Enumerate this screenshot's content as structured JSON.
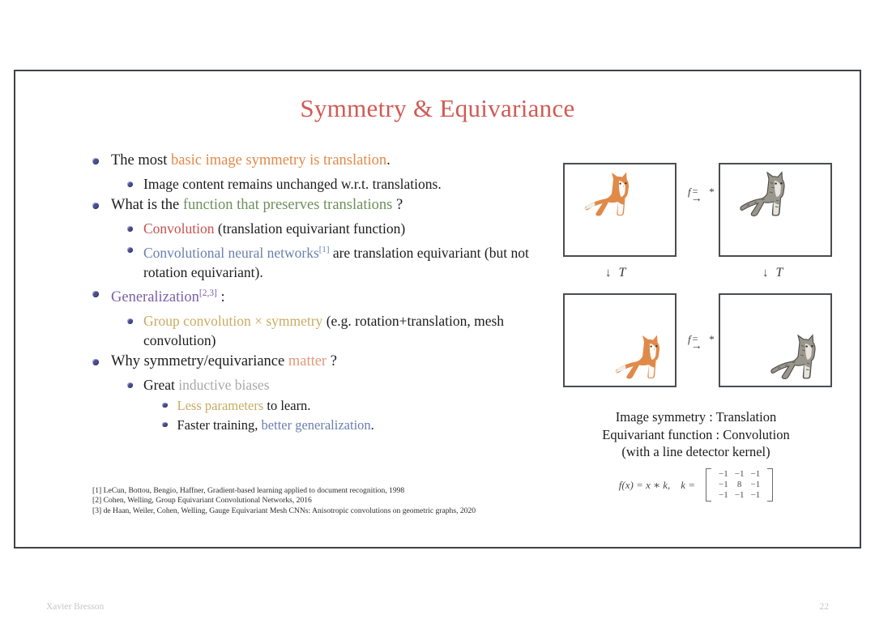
{
  "slide": {
    "title": "Symmetry & Equivariance",
    "page_number": "22",
    "author": "Xavier Bresson",
    "border_color": "#3f4246",
    "title_color": "#d15a54"
  },
  "colors": {
    "orange": "#e08a49",
    "green": "#6e8f5c",
    "red": "#c8514f",
    "blue": "#6a7fae",
    "purple": "#7c5fa6",
    "gold": "#c9ab62",
    "gray": "#a9a9ac",
    "salmon": "#e09a7c",
    "bullet": "#4a4f96"
  },
  "bullets": {
    "b1": {
      "pre": "The most ",
      "hl": "basic image symmetry is translation",
      "post": "."
    },
    "b1s1": {
      "text": "Image content remains unchanged w.r.t. translations."
    },
    "b2": {
      "pre": "What is the ",
      "hl": "function that preserves translations",
      "post": " ?"
    },
    "b2s1": {
      "hl": "Convolution",
      "post": " (translation equivariant function)"
    },
    "b2s2": {
      "hl": "Convolutional neural networks",
      "sup": "[1]",
      "post": " are translation equivariant (but not rotation equivariant)."
    },
    "b3": {
      "hl": "Generalization",
      "sup": "[2,3]",
      "post": " :"
    },
    "b3s1": {
      "hl": "Group convolution × symmetry",
      "post": " (e.g. rotation+translation, mesh convolution)"
    },
    "b4": {
      "pre": "Why symmetry/equivariance ",
      "hl": "matter",
      "post": " ?"
    },
    "b4s1": {
      "pre": "Great ",
      "hl": "inductive biases"
    },
    "b4s1a": {
      "hl": "Less parameters",
      "post": " to learn."
    },
    "b4s1b": {
      "pre": "Faster training, ",
      "hl": "better generalization",
      "post": "."
    }
  },
  "references": {
    "r1": "[1] LeCun, Bottou, Bengio, Haffner, Gradient-based learning applied to document recognition, 1998",
    "r2": "[2] Cohen, Welling, Group Equivariant Convolutional Networks, 2016",
    "r3": "[3] de Haan, Weiler, Cohen, Welling, Gauge Equivariant Mesh CNNs: Anisotropic convolutions on geometric graphs, 2020"
  },
  "diagram": {
    "arrow_f_label": "f",
    "arrow_f_eq": "=",
    "arrow_f_star": "*",
    "arrow_t_label": "T",
    "arrow_t_glyph": "↓",
    "arrow_right_glyph": "→",
    "caption_line1": "Image symmetry : Translation",
    "caption_line2": "Equivariant function : Convolution",
    "caption_line3": "(with a line detector kernel)",
    "formula_lhs": "f(x) = x ∗ k,",
    "formula_k": "k =",
    "kernel": [
      [
        "−1",
        "−1",
        "−1"
      ],
      [
        "−1",
        "8",
        "−1"
      ],
      [
        "−1",
        "−1",
        "−1"
      ]
    ],
    "boxes": [
      {
        "name": "original-image",
        "cat": "orange",
        "position": "top-left"
      },
      {
        "name": "convolved-image",
        "cat": "gray",
        "position": "top-left"
      },
      {
        "name": "translated-image",
        "cat": "orange",
        "position": "bottom-right"
      },
      {
        "name": "convolved-translated-image",
        "cat": "gray",
        "position": "bottom-right"
      }
    ]
  }
}
